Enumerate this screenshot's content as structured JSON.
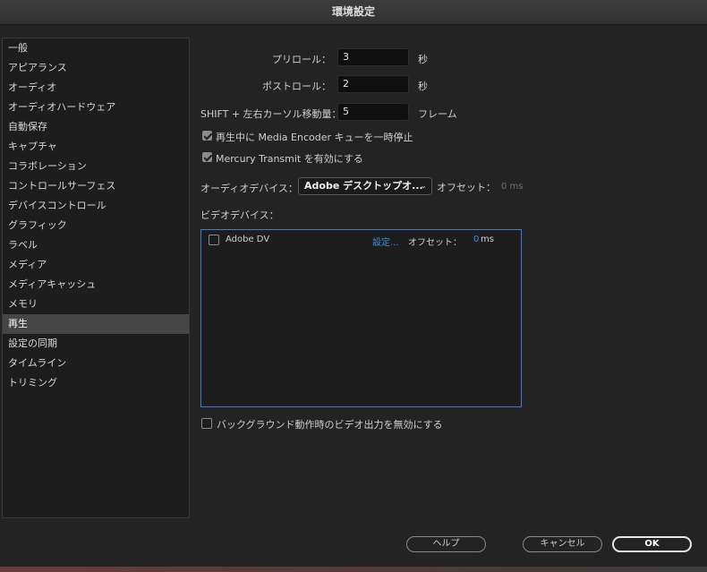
{
  "window": {
    "title": "環境設定"
  },
  "sidebar": {
    "items": [
      {
        "label": "一般"
      },
      {
        "label": "アピアランス"
      },
      {
        "label": "オーディオ"
      },
      {
        "label": "オーディオハードウェア"
      },
      {
        "label": "自動保存"
      },
      {
        "label": "キャプチャ"
      },
      {
        "label": "コラボレーション"
      },
      {
        "label": "コントロールサーフェス"
      },
      {
        "label": "デバイスコントロール"
      },
      {
        "label": "グラフィック"
      },
      {
        "label": "ラベル"
      },
      {
        "label": "メディア"
      },
      {
        "label": "メディアキャッシュ"
      },
      {
        "label": "メモリ"
      },
      {
        "label": "再生"
      },
      {
        "label": "設定の同期"
      },
      {
        "label": "タイムライン"
      },
      {
        "label": "トリミング"
      }
    ],
    "selected": "再生"
  },
  "playback": {
    "preroll": {
      "label": "プリロール：",
      "value": "3",
      "unit": "秒"
    },
    "postroll": {
      "label": "ポストロール：",
      "value": "2",
      "unit": "秒"
    },
    "shift_move": {
      "label": "SHIFT + 左右カーソル移動量：",
      "value": "5",
      "unit": "フレーム"
    },
    "pause_media_encoder": {
      "label": "再生中に Media Encoder キューを一時停止",
      "checked": true
    },
    "mercury_transmit": {
      "label": "Mercury Transmit を有効にする",
      "checked": true
    },
    "audio_device": {
      "label": "オーディオデバイス：",
      "value": "Adobe デスクトップオ...",
      "offset_label": "オフセット：",
      "offset_value": "0 ms"
    },
    "video_device": {
      "label": "ビデオデバイス：",
      "devices": [
        {
          "name": "Adobe DV",
          "checked": false,
          "settings_link": "設定...",
          "offset_label": "オフセット：",
          "offset_value": "0",
          "offset_unit": "ms"
        }
      ]
    },
    "disable_background_video": {
      "label": "バックグラウンド動作時のビデオ出力を無効にする",
      "checked": false
    }
  },
  "buttons": {
    "help": "ヘルプ",
    "cancel": "キャンセル",
    "ok": "OK"
  }
}
